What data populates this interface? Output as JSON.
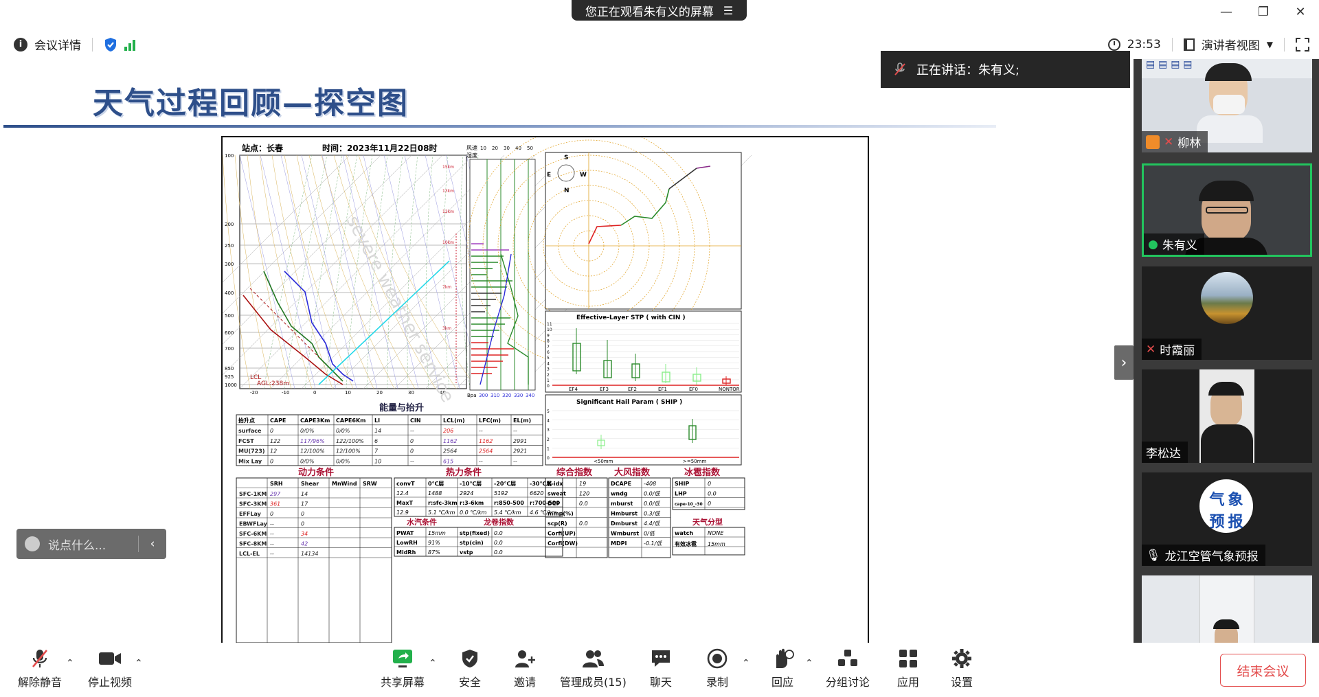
{
  "titlebar": {
    "share_banner": "您正在观看朱有义的屏幕"
  },
  "top_toolbar": {
    "meeting_details": "会议详情",
    "time": "23:53",
    "view_mode": "演讲者视图"
  },
  "slide": {
    "title": "天气过程回顾—探空图",
    "chart": {
      "station": "站点：长春",
      "time": "时间：2023年11月22日08时",
      "lcl_label": "LCL",
      "agl_label": "AGL:238m",
      "watermark": "severe weather service",
      "pressure_ticks": [
        "100",
        "200",
        "250",
        "300",
        "400",
        "500",
        "600",
        "700",
        "850",
        "925",
        "1000"
      ],
      "temp_ticks": [
        "-20",
        "-10",
        "0",
        "10",
        "20",
        "30",
        "40"
      ],
      "wind_header_1": "风速",
      "wind_header_2": "湿度",
      "wind_ticks": [
        "10",
        "20",
        "30",
        "40",
        "50"
      ],
      "theta_ticks": [
        "Bpa",
        "300",
        "310",
        "320",
        "330",
        "340"
      ],
      "hodo_dirs": {
        "n": "N",
        "s": "S",
        "e": "E",
        "w": "W"
      },
      "stp_title": "Effective-Layer STP ( with CIN )",
      "stp_cats": [
        "EF4",
        "EF3",
        "EF2",
        "EF1",
        "EF0",
        "NONTOR"
      ],
      "stp_yticks": [
        "11",
        "10",
        "9",
        "8",
        "7",
        "6",
        "5",
        "4",
        "3",
        "2",
        "1",
        "0"
      ],
      "ship_title": "Significant Hail Param ( SHIP )",
      "ship_cats": [
        "<50mm",
        ">=50mm"
      ],
      "ship_yticks": [
        "5",
        "4",
        "3",
        "2",
        "1",
        "0"
      ],
      "energy_title": "能量与抬升",
      "energy_headers": [
        "抬升点",
        "CAPE",
        "CAPE3Km",
        "CAPE6Km",
        "LI",
        "CIN",
        "LCL(m)",
        "LFC(m)",
        "EL(m)"
      ],
      "energy_rows": [
        [
          "surface",
          "0",
          "0/0%",
          "0/0%",
          "14",
          "--",
          "206",
          "--",
          "--"
        ],
        [
          "FCST",
          "122",
          "117/96%",
          "122/100%",
          "6",
          "0",
          "1162",
          "1162",
          "2991"
        ],
        [
          "MU(723)",
          "12",
          "12/100%",
          "12/100%",
          "7",
          "0",
          "2564",
          "2564",
          "2921"
        ],
        [
          "Mix Lay",
          "0",
          "0/0%",
          "0/0%",
          "10",
          "--",
          "615",
          "--",
          "--"
        ]
      ],
      "dyn_title": "动力条件",
      "thermo_title": "热力条件",
      "comp_title": "综合指数",
      "gale_title": "大风指数",
      "hail_title": "冰雹指数",
      "vapor_title": "水汽条件",
      "tornado_title": "龙卷指数",
      "pattern_title": "天气分型",
      "dyn_headers": [
        "",
        "SRH",
        "Shear",
        "MnWind",
        "SRW"
      ],
      "dyn_rows": [
        [
          "SFC-1KM",
          "297",
          "14"
        ],
        [
          "SFC-3KM",
          "361",
          "17"
        ],
        [
          "EFFLay",
          "0",
          "0"
        ],
        [
          "EBWFLay",
          "--",
          "0"
        ],
        [
          "SFC-6KM",
          "--",
          "34"
        ],
        [
          "SFC-8KM",
          "--",
          "42"
        ],
        [
          "LCL-EL",
          "--",
          "14134"
        ]
      ],
      "thermo_headers": [
        "convT",
        "0℃层",
        "-10℃层",
        "-20℃层",
        "-30℃层"
      ],
      "thermo_row1": [
        "12.4",
        "1488",
        "2924",
        "5192",
        "6620"
      ],
      "thermo_headers2": [
        "MaxT",
        "r:sfc-3km",
        "r:3-6km",
        "r:850-500",
        "r:700-500"
      ],
      "thermo_row2": [
        "12.9",
        "5.1 ℃/km",
        "0.0 ℃/km",
        "5.4 ℃/km",
        "4.6 ℃/km"
      ],
      "vapor_rows": [
        [
          "PWAT",
          "15mm"
        ],
        [
          "LowRH",
          "91%"
        ],
        [
          "MidRh",
          "87%"
        ]
      ],
      "tornado_rows": [
        [
          "stp(fixed)",
          "0.0"
        ],
        [
          "stp(cin)",
          "0.0"
        ],
        [
          "vstp",
          "0.0"
        ]
      ],
      "comp_rows": [
        [
          "K-idx",
          "19"
        ],
        [
          "sweat",
          "120"
        ],
        [
          "DCP",
          "0.0"
        ],
        [
          "mmp(%)",
          ""
        ],
        [
          "scp(R)",
          "0.0"
        ],
        [
          "Corfi(UP)",
          ""
        ],
        [
          "Corfi(DW)",
          ""
        ]
      ],
      "gale_rows": [
        [
          "DCAPE",
          "-408"
        ],
        [
          "wndg",
          "0.0/低"
        ],
        [
          "mburst",
          "0.0/低"
        ],
        [
          "Hmburst",
          "0.3/低"
        ],
        [
          "Dmburst",
          "4.4/低"
        ],
        [
          "Wmburst",
          "0/低"
        ],
        [
          "MDPI",
          "-0.1/低"
        ]
      ],
      "hail_rows": [
        [
          "SHIP",
          "0"
        ],
        [
          "LHP",
          "0.0"
        ],
        [
          "cape-10_-30",
          "0"
        ]
      ],
      "pattern_rows": [
        [
          "watch",
          "NONE"
        ],
        [
          "有效冰雹",
          "15mm"
        ]
      ]
    }
  },
  "speaker_bar": {
    "text": "正在讲话：朱有义;"
  },
  "participants": [
    {
      "name": "柳林"
    },
    {
      "name": "朱有义"
    },
    {
      "name": "时霞丽"
    },
    {
      "name": "李松达"
    },
    {
      "name": "龙江空管气象预报",
      "logo_text": [
        "气",
        "象",
        "预",
        "报"
      ]
    },
    {
      "name": ""
    }
  ],
  "chat": {
    "placeholder": "说点什么..."
  },
  "bottom_bar": {
    "unmute": "解除静音",
    "stop_video": "停止视频",
    "share": "共享屏幕",
    "security": "安全",
    "invite": "邀请",
    "manage": "管理成员(15)",
    "chat": "聊天",
    "record": "录制",
    "react": "回应",
    "breakout": "分组讨论",
    "apps": "应用",
    "settings": "设置",
    "end": "结束会议"
  },
  "colors": {
    "accent_green": "#22c55e",
    "end_red": "#e34c4c",
    "title_blue": "#2e4f8a"
  }
}
